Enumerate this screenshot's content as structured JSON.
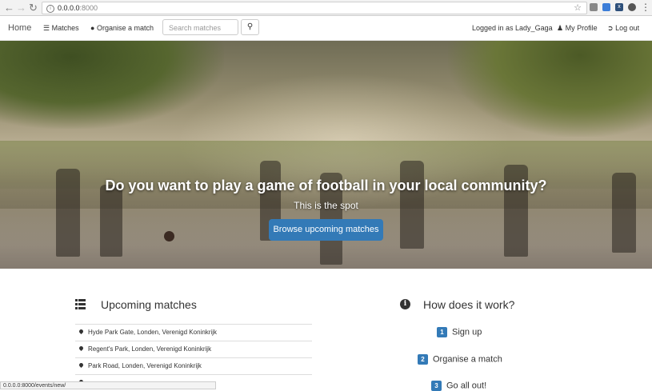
{
  "browser": {
    "url_host": "0.0.0.0",
    "url_port": ":8000",
    "status_url": "0.0.0.0:8000/events/new/"
  },
  "navbar": {
    "brand": "Home",
    "matches_label": "Matches",
    "organise_label": "Organise a match",
    "search_placeholder": "Search matches",
    "logged_in_text": "Logged in as Lady_Gaga",
    "profile_label": "My Profile",
    "logout_label": "Log out"
  },
  "hero": {
    "title": "Do you want to play a game of football in your local community?",
    "subtitle": "This is the spot",
    "button_label": "Browse upcoming matches"
  },
  "upcoming": {
    "title": "Upcoming matches",
    "items": [
      "Hyde Park Gate, Londen, Verenigd Koninkrijk",
      "Regent's Park, Londen, Verenigd Koninkrijk",
      "Park Road, Londen, Verenigd Koninkrijk"
    ]
  },
  "how": {
    "title": "How does it work?",
    "steps": [
      {
        "num": "1",
        "label": "Sign up"
      },
      {
        "num": "2",
        "label": "Organise a match"
      },
      {
        "num": "3",
        "label": "Go all out!"
      }
    ]
  },
  "colors": {
    "primary": "#337ab7"
  }
}
